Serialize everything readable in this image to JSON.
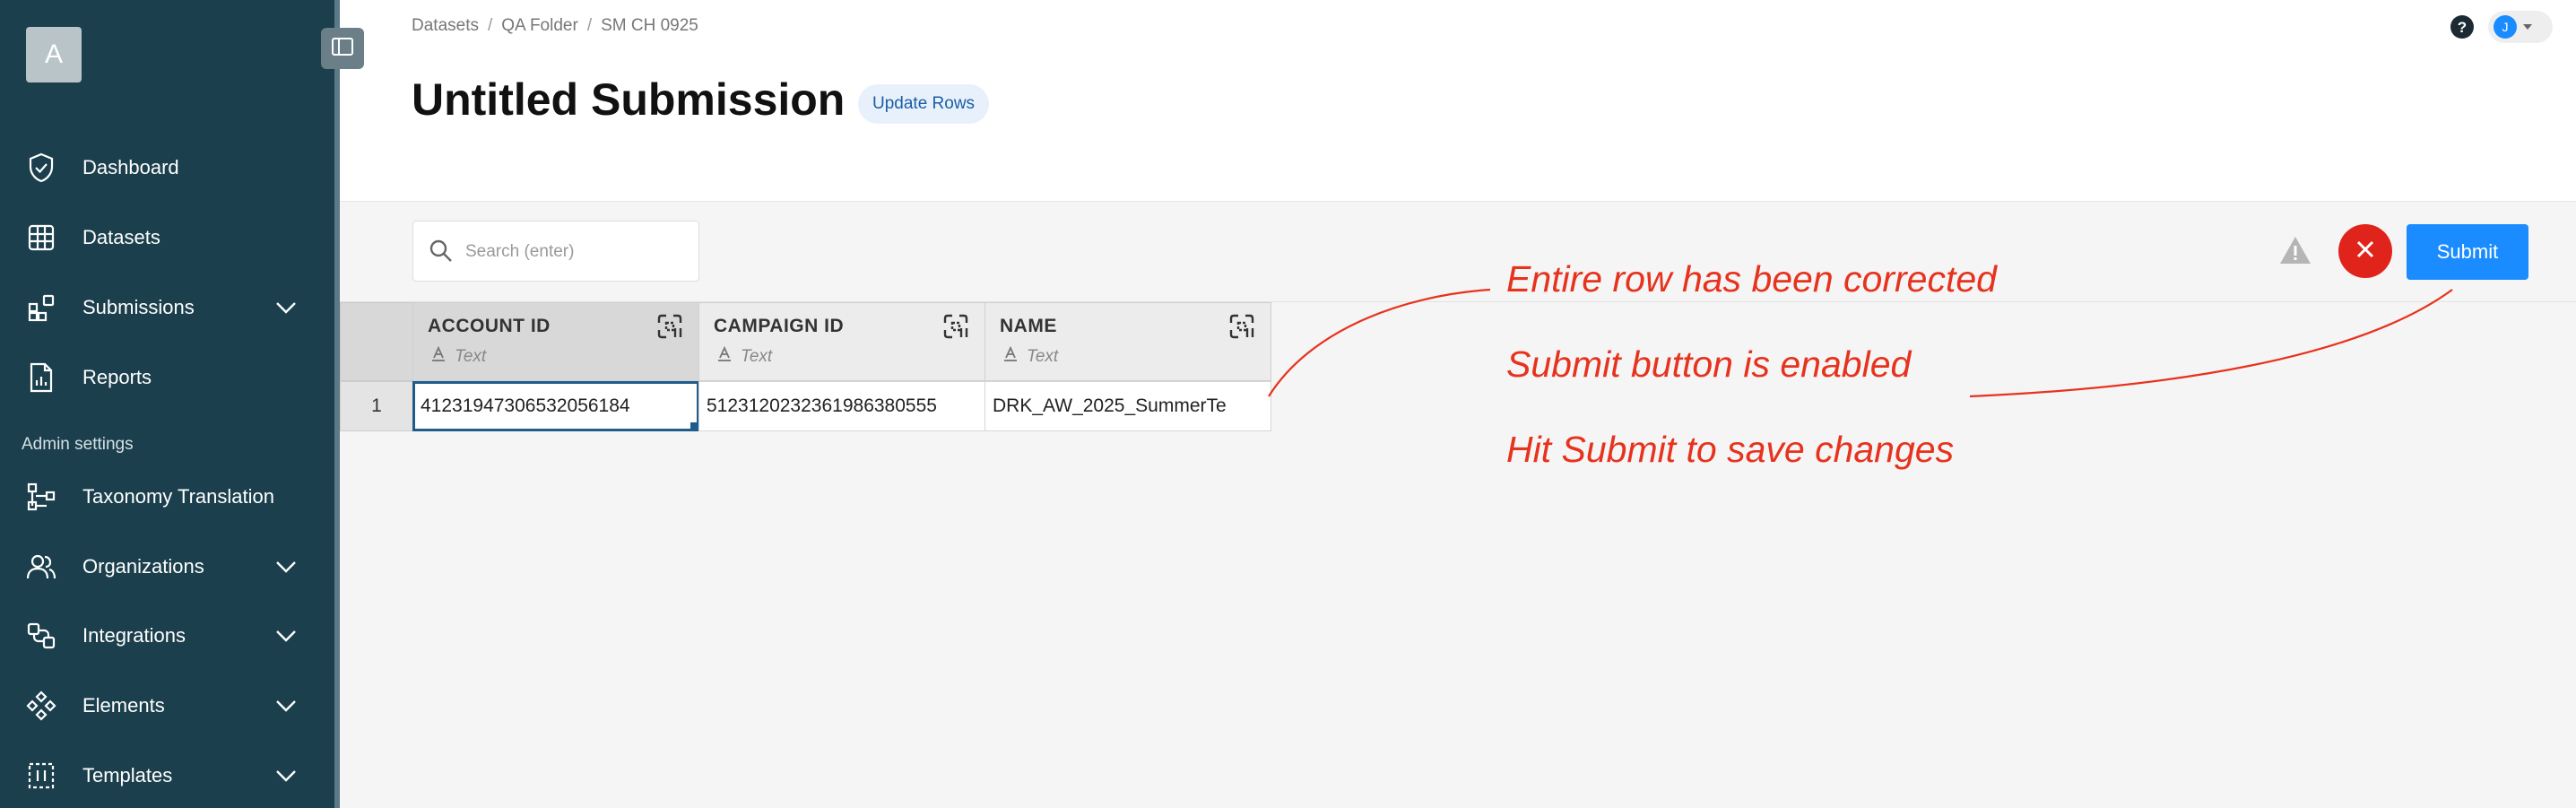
{
  "sidebar": {
    "org_initial": "A",
    "items": [
      {
        "label": "Dashboard",
        "icon": "shield-check-icon"
      },
      {
        "label": "Datasets",
        "icon": "grid-icon"
      },
      {
        "label": "Submissions",
        "icon": "blocks-icon"
      },
      {
        "label": "Reports",
        "icon": "report-icon"
      }
    ],
    "admin_label": "Admin settings",
    "admin_items": [
      {
        "label": "Taxonomy Translation",
        "icon": "flow-icon"
      },
      {
        "label": "Organizations",
        "icon": "users-icon"
      },
      {
        "label": "Integrations",
        "icon": "integrations-icon"
      },
      {
        "label": "Elements",
        "icon": "diamond-grid-icon"
      },
      {
        "label": "Templates",
        "icon": "template-icon"
      }
    ]
  },
  "header": {
    "breadcrumb": [
      "Datasets",
      "QA Folder",
      "SM CH 0925"
    ],
    "breadcrumb_sep": "/",
    "title": "Untitled Submission",
    "badge": "Update Rows",
    "user_initial": "J"
  },
  "toolbar": {
    "search_placeholder": "Search (enter)",
    "submit_label": "Submit"
  },
  "grid": {
    "columns": [
      {
        "name": "ACCOUNT ID",
        "type": "Text"
      },
      {
        "name": "CAMPAIGN ID",
        "type": "Text"
      },
      {
        "name": "NAME",
        "type": "Text"
      }
    ],
    "rows": [
      {
        "num": "1",
        "cells": [
          "41231947306532056184",
          "5123120232361986380555",
          "DRK_AW_2025_SummerTe"
        ]
      }
    ]
  },
  "annotations": [
    "Entire row has been corrected",
    "Submit button is enabled",
    "Hit Submit to save changes"
  ],
  "colors": {
    "sidebar": "#1b3f4d",
    "accent": "#1a8cff",
    "danger": "#e0241c",
    "annotation": "#e7321d"
  }
}
